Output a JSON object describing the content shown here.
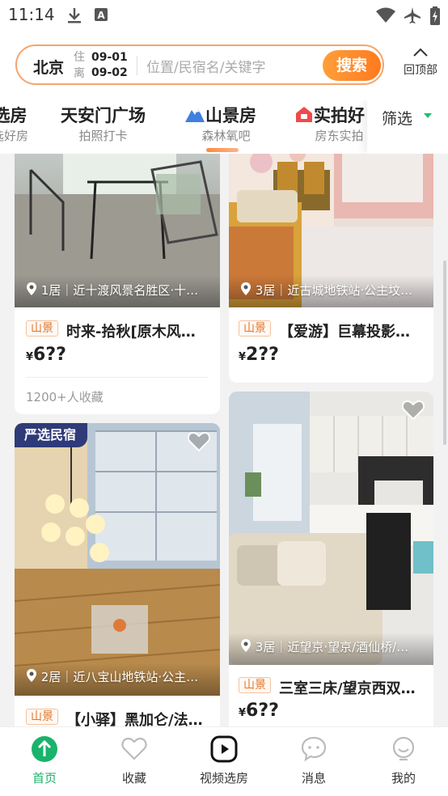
{
  "status_bar": {
    "time": "11:14",
    "icons": [
      "download-icon",
      "keyboard-a-icon",
      "wifi-icon",
      "airplane-icon",
      "battery-charging-icon"
    ]
  },
  "header": {
    "city": "北京",
    "check_in_label": "住",
    "check_out_label": "离",
    "check_in_date": "09-01",
    "check_out_date": "09-02",
    "search_placeholder": "位置/民宿名/关键字",
    "search_button": "搜索",
    "back_to_top": "回顶部",
    "accent_color": "#ff8a2a"
  },
  "categories": [
    {
      "title": "选房",
      "subtitle": "选好房",
      "icon": ""
    },
    {
      "title": "天安门广场",
      "subtitle": "拍照打卡",
      "icon": ""
    },
    {
      "title": "山景房",
      "subtitle": "森林氧吧",
      "icon": "mountain-icon",
      "active": true
    },
    {
      "title": "实拍好",
      "subtitle": "房东实拍",
      "icon": "house-icon"
    }
  ],
  "filter": {
    "label": "筛选"
  },
  "listings": [
    {
      "location": "1居｜近十渡风景名胜区·十…",
      "tag": "山景",
      "title": "时来-拾秋[原木风…",
      "currency": "¥",
      "price": "6??",
      "favorites": "1200+人收藏"
    },
    {
      "location": "3居｜近古城地铁站·公主坟…",
      "tag": "山景",
      "title": "【爱游】巨幕投影…",
      "currency": "¥",
      "price": "2??"
    },
    {
      "badge": "严选民宿",
      "location": "2居｜近八宝山地铁站·公主…",
      "tag": "山景",
      "title": "【小驿】黑加仑/法…",
      "currency": "¥",
      "price": ""
    },
    {
      "location": "3居｜近望京·望京/酒仙桥/…",
      "tag": "山景",
      "title": "三室三床/望京西双…",
      "currency": "¥",
      "price": "6??"
    }
  ],
  "bottom_nav": [
    {
      "label": "首页",
      "icon": "home-arrow-up-icon",
      "active": true
    },
    {
      "label": "收藏",
      "icon": "heart-icon"
    },
    {
      "label": "视频选房",
      "icon": "video-play-icon"
    },
    {
      "label": "消息",
      "icon": "chat-bubble-icon"
    },
    {
      "label": "我的",
      "icon": "smiley-user-icon"
    }
  ]
}
